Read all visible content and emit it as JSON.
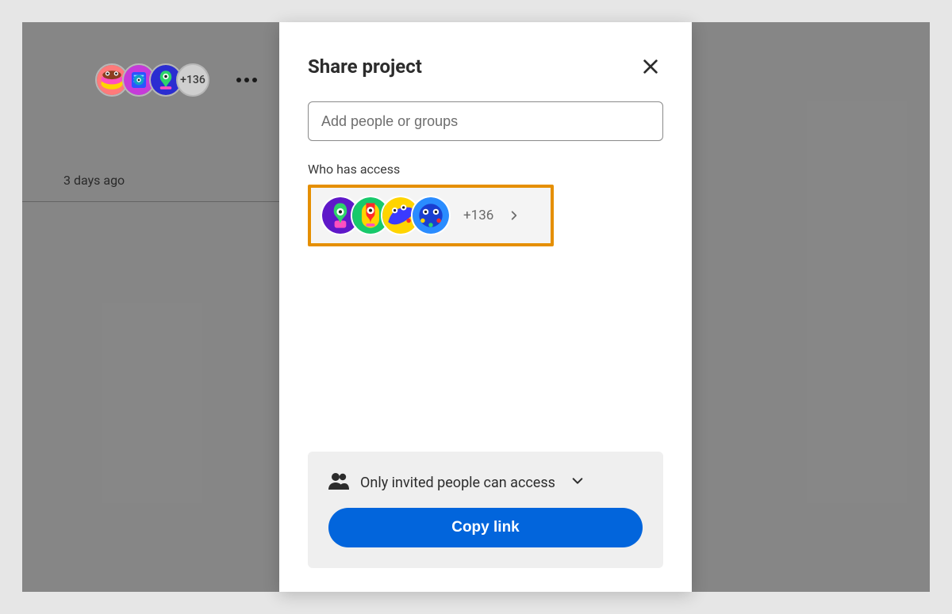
{
  "background": {
    "overflow_count": "+136",
    "timestamp": "3 days ago"
  },
  "modal": {
    "title": "Share project",
    "search_placeholder": "Add people or groups",
    "access_label": "Who has access",
    "overflow_count": "+136",
    "access_setting": "Only invited people can access",
    "copy_button": "Copy link"
  },
  "icons": {
    "close": "close-icon",
    "more": "more-horizontal-icon",
    "chevron_right": "chevron-right-icon",
    "chevron_down": "chevron-down-icon",
    "people": "people-icon"
  }
}
